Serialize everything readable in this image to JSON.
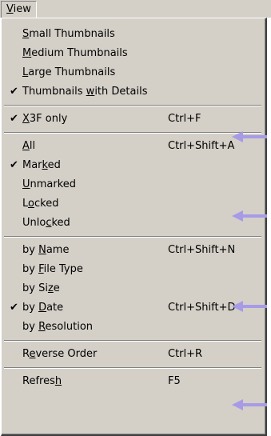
{
  "menubar": {
    "title": "View",
    "title_underline_index": 0
  },
  "menu": {
    "groups": [
      [
        {
          "label": "Small Thumbnails",
          "u": 0,
          "checked": false,
          "shortcut": ""
        },
        {
          "label": "Medium Thumbnails",
          "u": 0,
          "checked": false,
          "shortcut": ""
        },
        {
          "label": "Large Thumbnails",
          "u": 0,
          "checked": false,
          "shortcut": ""
        },
        {
          "label": "Thumbnails with Details",
          "u": 11,
          "checked": true,
          "shortcut": ""
        }
      ],
      [
        {
          "label": "X3F only",
          "u": 0,
          "checked": true,
          "shortcut": "Ctrl+F"
        }
      ],
      [
        {
          "label": "All",
          "u": 0,
          "checked": false,
          "shortcut": "Ctrl+Shift+A"
        },
        {
          "label": "Marked",
          "u": 3,
          "checked": true,
          "shortcut": ""
        },
        {
          "label": "Unmarked",
          "u": 0,
          "checked": false,
          "shortcut": ""
        },
        {
          "label": "Locked",
          "u": 1,
          "checked": false,
          "shortcut": ""
        },
        {
          "label": "Unlocked",
          "u": 4,
          "checked": false,
          "shortcut": ""
        }
      ],
      [
        {
          "label": "by Name",
          "u": 3,
          "checked": false,
          "shortcut": "Ctrl+Shift+N"
        },
        {
          "label": "by File Type",
          "u": 3,
          "checked": false,
          "shortcut": ""
        },
        {
          "label": "by Size",
          "u": 5,
          "checked": false,
          "shortcut": ""
        },
        {
          "label": "by Date",
          "u": 3,
          "checked": true,
          "shortcut": "Ctrl+Shift+D"
        },
        {
          "label": "by Resolution",
          "u": 3,
          "checked": false,
          "shortcut": ""
        }
      ],
      [
        {
          "label": "Reverse Order",
          "u": 1,
          "checked": false,
          "shortcut": "Ctrl+R"
        }
      ],
      [
        {
          "label": "Refresh",
          "u": 6,
          "checked": false,
          "shortcut": "F5"
        }
      ]
    ]
  },
  "check_glyph": "✔",
  "arrow_color": "#a89be6",
  "arrow_icon": "left-arrow-icon"
}
